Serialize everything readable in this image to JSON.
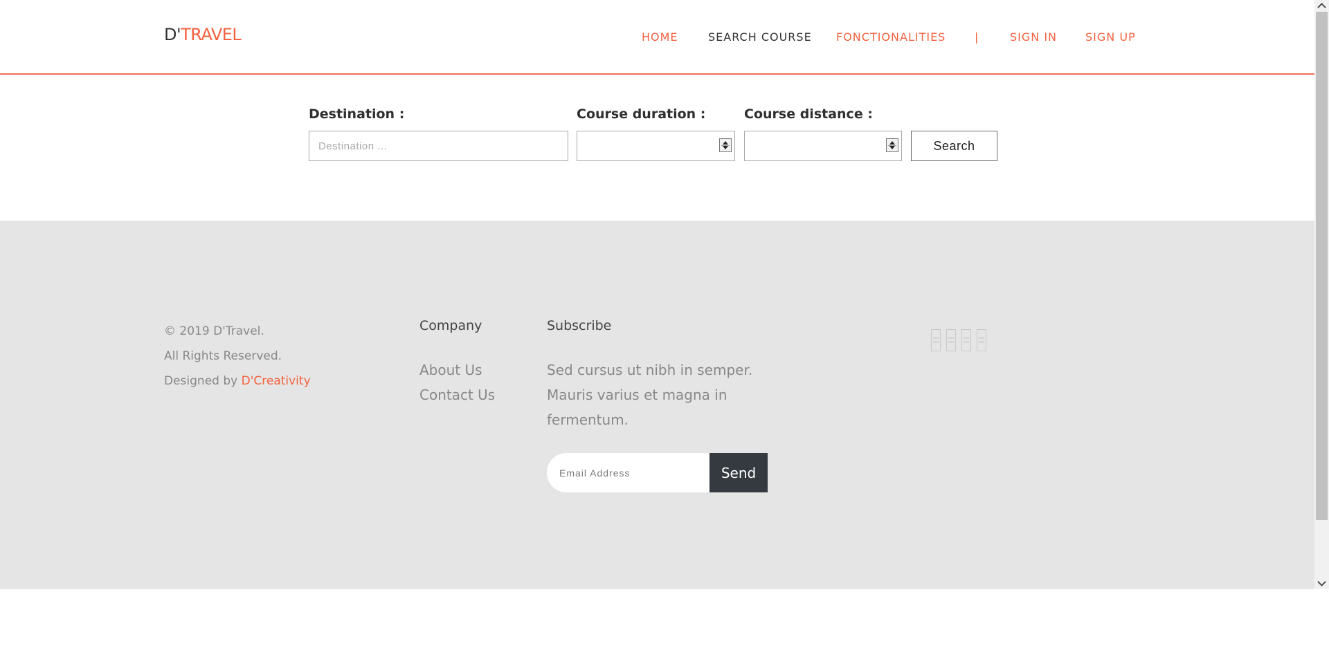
{
  "header": {
    "logo_prefix": "D'",
    "logo_suffix": "TRAVEL",
    "nav": {
      "home": "HOME",
      "search_course": "SEARCH COURSE",
      "fonctionalities": "FONCTIONALITIES",
      "separator": "|",
      "sign_in": "SIGN IN",
      "sign_up": "SIGN UP"
    }
  },
  "search": {
    "destination_label": "Destination :",
    "destination_placeholder": "Destination ...",
    "duration_label": "Course duration :",
    "distance_label": "Course distance :",
    "button_label": "Search"
  },
  "footer": {
    "copyright": "© 2019 D'Travel.",
    "rights": "All Rights Reserved.",
    "designed_by_prefix": "Designed by ",
    "designed_by_link": "D'Creativity",
    "company_heading": "Company",
    "company_links": [
      "About Us",
      "Contact Us"
    ],
    "subscribe_heading": "Subscribe",
    "subscribe_text": [
      "Sed cursus ut nibh in semper.",
      "Mauris varius et magna in",
      "fermentum."
    ],
    "email_placeholder": "Email Address",
    "send_label": "Send",
    "social_icons": [
      "facebook-icon",
      "twitter-icon",
      "instagram-icon",
      "linkedin-icon"
    ]
  },
  "colors": {
    "accent": "#f4613f",
    "footer_bg": "#e5e5e5",
    "send_bg": "#343a40"
  }
}
